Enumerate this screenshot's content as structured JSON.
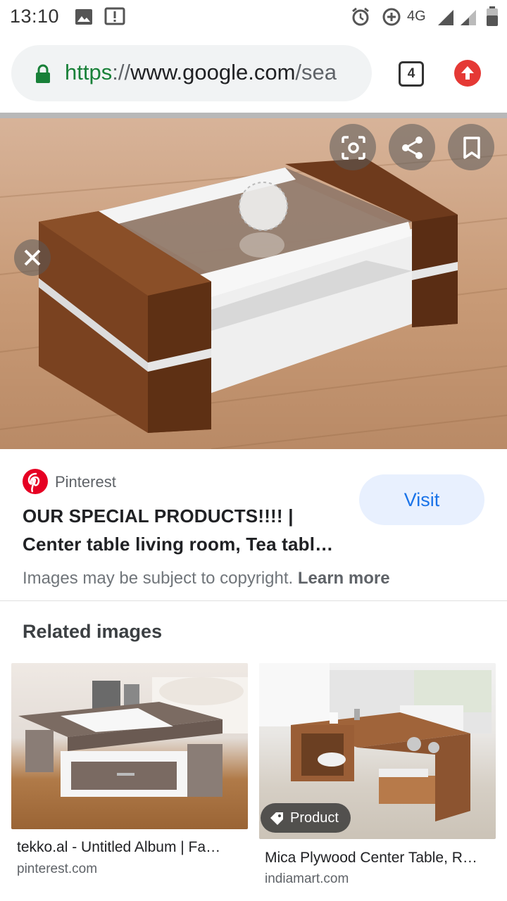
{
  "status_bar": {
    "time": "13:10",
    "network": "4G"
  },
  "browser": {
    "url_scheme": "https",
    "url_separator": "://",
    "url_host": "www.google.com",
    "url_path": "/sea",
    "tab_count": "4"
  },
  "result": {
    "source": "Pinterest",
    "visit_label": "Visit",
    "title_line1": "OUR SPECIAL PRODUCTS!!!! |",
    "title_line2": "Center table living room, Tea tabl…",
    "copyright_text": "Images may be subject to copyright.",
    "learn_more": "Learn more"
  },
  "related": {
    "heading": "Related images",
    "items": [
      {
        "title": "tekko.al - Untitled Album | Fa…",
        "site": "pinterest.com"
      },
      {
        "title": "Mica Plywood Center Table, R…",
        "site": "indiamart.com",
        "badge": "Product"
      }
    ]
  },
  "colors": {
    "brand_pinterest": "#e60023",
    "visit_bg": "#e8f0fe",
    "visit_text": "#1a73e8",
    "secure_green": "#188038"
  },
  "icons": [
    "photo-icon",
    "alert-icon",
    "alarm-icon",
    "data-saver-icon",
    "signal-icon",
    "battery-icon",
    "lock-icon",
    "close-icon",
    "lens-icon",
    "share-icon",
    "bookmark-icon",
    "pinterest-icon",
    "tag-icon",
    "upload-icon"
  ]
}
